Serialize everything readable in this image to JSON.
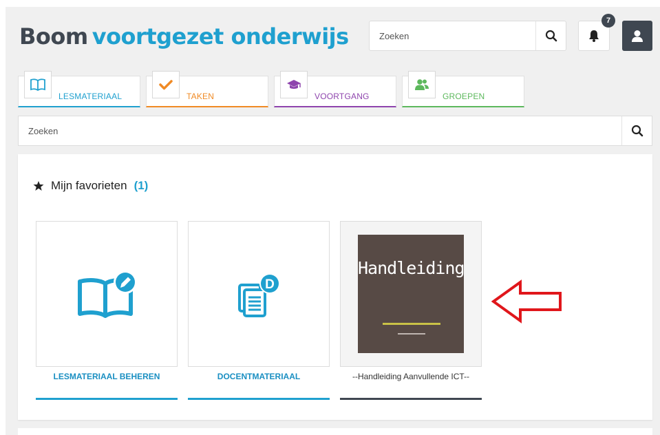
{
  "header": {
    "brand_part1": "Boom",
    "brand_part2": "voortgezet onderwijs",
    "search_placeholder": "Zoeken",
    "notifications_count": "7",
    "icons": {
      "search": "search-icon",
      "bell": "bell-icon",
      "user": "user-icon"
    }
  },
  "tabs": [
    {
      "label": "LESMATERIAAL",
      "color": "#1fa0cf",
      "icon": "book-icon"
    },
    {
      "label": "TAKEN",
      "color": "#f08a24",
      "icon": "check-icon"
    },
    {
      "label": "VOORTGANG",
      "color": "#8e44ad",
      "icon": "graduation-cap-icon"
    },
    {
      "label": "GROEPEN",
      "color": "#5cb85c",
      "icon": "users-icon"
    }
  ],
  "content_search": {
    "placeholder": "Zoeken"
  },
  "favorites": {
    "title": "Mijn favorieten",
    "count": "(1)",
    "cards": [
      {
        "label": "LESMATERIAAL BEHEREN",
        "icon": "book-edit-icon"
      },
      {
        "label": "DOCENTMATERIAAL",
        "icon": "documents-d-icon"
      },
      {
        "label": "--Handleiding Aanvullende ICT--",
        "cover_title": "Handleiding"
      }
    ]
  },
  "colors": {
    "brand_dark": "#3f4751",
    "brand_blue": "#1fa0cf",
    "arrow_red": "#e0161b",
    "cover_bg": "#574a45"
  }
}
